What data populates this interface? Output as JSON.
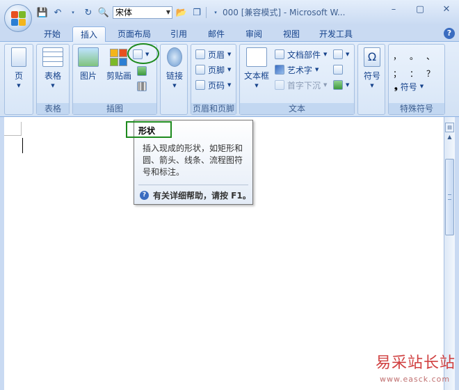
{
  "titlebar": {
    "font_name": "宋体",
    "doc_title": "000 [兼容模式] - Microsoft W...",
    "qat_icons": [
      "save-icon",
      "undo-icon",
      "redo-icon",
      "print-preview-icon"
    ],
    "window_controls": [
      "–",
      "▢",
      "✕"
    ]
  },
  "tabs": [
    "开始",
    "插入",
    "页面布局",
    "引用",
    "邮件",
    "审阅",
    "视图",
    "开发工具"
  ],
  "active_tab": "插入",
  "ribbon": {
    "page_group": {
      "label": "",
      "page": "页"
    },
    "table_group": {
      "label": "表格",
      "table": "表格"
    },
    "illustrations_group": {
      "label": "插图",
      "picture": "图片",
      "clipart": "剪贴画"
    },
    "links_group": {
      "label": "",
      "link": "链接"
    },
    "header_footer_group": {
      "label": "页眉和页脚",
      "header": "页眉",
      "footer": "页脚",
      "page_number": "页码"
    },
    "text_group": {
      "label": "文本",
      "textbox": "文本框",
      "quickparts": "文档部件",
      "wordart": "艺术字",
      "dropcap": "首字下沉"
    },
    "symbols_group": {
      "symbol": "符号"
    },
    "special_group": {
      "label": "特殊符号",
      "chars": [
        "，",
        "。",
        "、",
        "；",
        "：",
        "？"
      ],
      "symbol": "符号"
    }
  },
  "tooltip": {
    "title": "形状",
    "body": "插入现成的形状，如矩形和圆、箭头、线条、流程图符号和标注。",
    "help": "有关详细帮助，请按 F1。"
  },
  "watermark": {
    "title": "易采站长站",
    "url": "www.easck.com"
  },
  "colors": {
    "accent": "#15428b",
    "ribbon_bg": "#d2e1f4",
    "highlight": "#1d8a1d"
  }
}
